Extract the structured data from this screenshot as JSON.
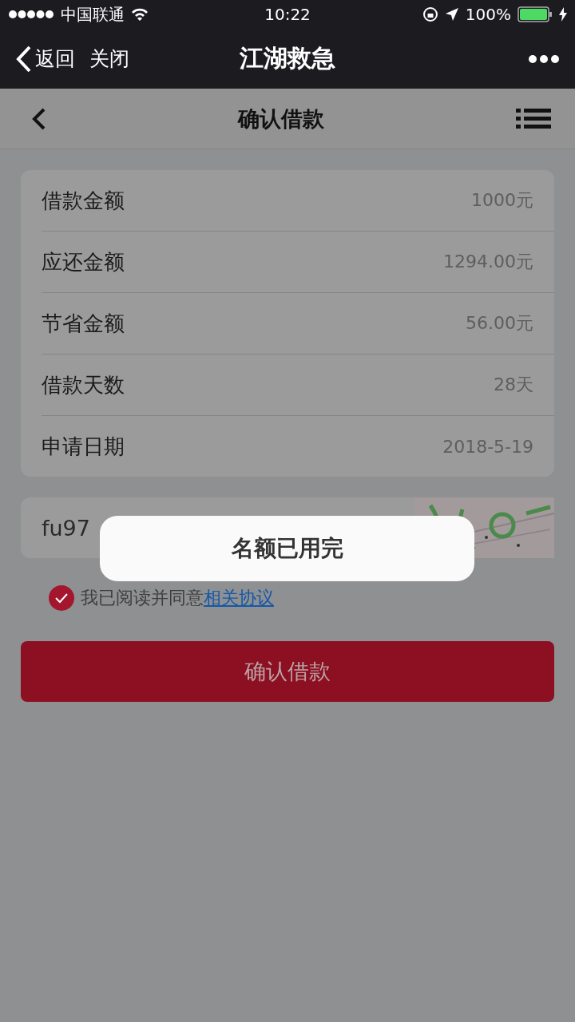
{
  "status_bar": {
    "carrier": "中国联通",
    "time": "10:22",
    "battery": "100%",
    "level": 1
  },
  "nav_bar": {
    "back": "返回",
    "close": "关闭",
    "title": "江湖救急"
  },
  "header": {
    "title": "确认借款"
  },
  "rows": [
    {
      "label": "借款金额",
      "value": "1000元"
    },
    {
      "label": "应还金额",
      "value": "1294.00元"
    },
    {
      "label": "节省金额",
      "value": "56.00元"
    },
    {
      "label": "借款天数",
      "value": "28天"
    },
    {
      "label": "申请日期",
      "value": "2018-5-19"
    }
  ],
  "captcha": {
    "value": "fu97"
  },
  "agreement": {
    "checked": true,
    "text": "我已阅读并同意",
    "link": "相关协议"
  },
  "confirm_button": "确认借款",
  "toast": "名额已用完"
}
